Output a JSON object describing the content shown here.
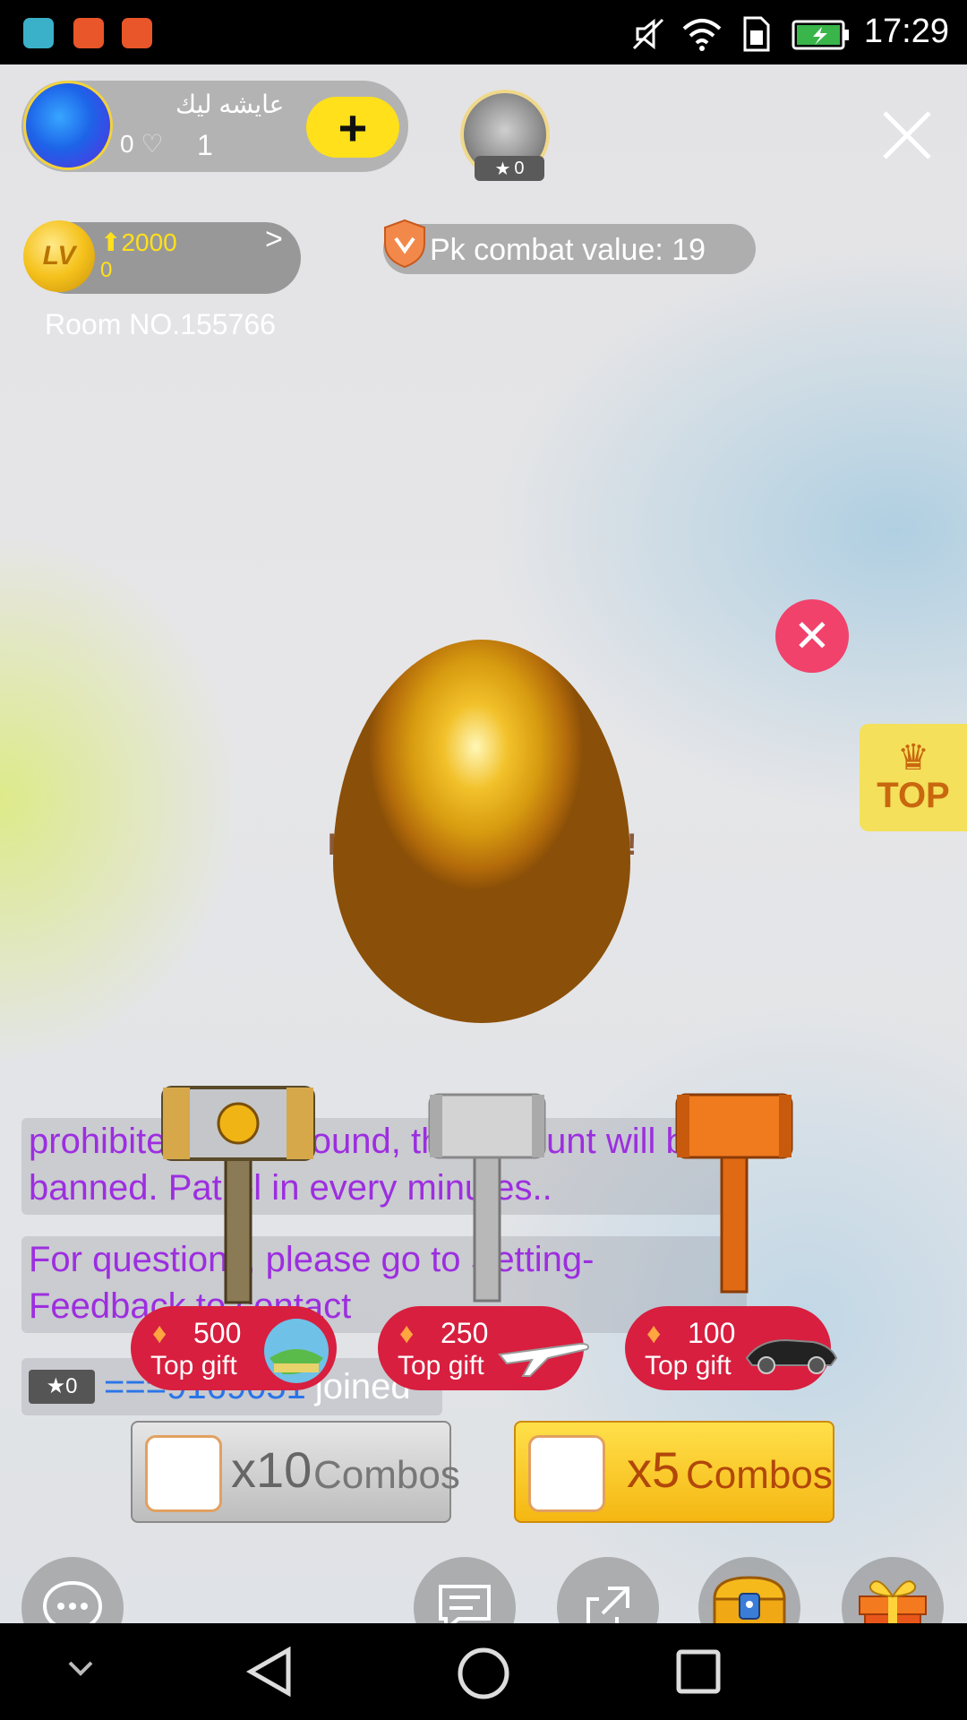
{
  "status_bar": {
    "time": "17:29",
    "icons": [
      "android-icon",
      "music-icon",
      "music-icon",
      "mute-icon",
      "wifi-icon",
      "sim-icon",
      "battery-icon"
    ]
  },
  "host": {
    "name": "عايشه ليك",
    "hearts": "0",
    "count": "1",
    "follow_label": "+"
  },
  "viewer": {
    "badge": "0"
  },
  "level": {
    "lv_label": "LV",
    "up_value": "2000",
    "current": "0",
    "arrow": ">"
  },
  "pk": {
    "text": "Pk combat value:  19"
  },
  "room": {
    "number": "Room NO.155766"
  },
  "egg_game": {
    "left_char": "I",
    "right_char": "!"
  },
  "top_badge": {
    "crown": "♛",
    "label": "TOP"
  },
  "chat": {
    "messages": [
      "prohibited. Once found, the account will be banned. Patrol in every minutes..",
      "For questions, please go to Setting-Feedback to contact"
    ],
    "join": {
      "badge": "0",
      "user": "===9169051",
      "action": "joined"
    }
  },
  "gifts": [
    {
      "price": "500",
      "label": "Top gift"
    },
    {
      "price": "250",
      "label": "Top gift"
    },
    {
      "price": "100",
      "label": "Top gift"
    }
  ],
  "combos": [
    {
      "multiplier": "x10",
      "word": "Combos"
    },
    {
      "multiplier": "x5",
      "word": "Combos"
    }
  ],
  "colors": {
    "accent_yellow": "#ffe01a",
    "gift_red": "#d81f3f",
    "chat_purple": "#9d2ee0",
    "close_pink": "#f0426b"
  }
}
